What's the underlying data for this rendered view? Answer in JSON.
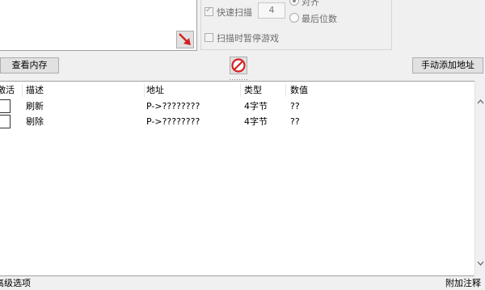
{
  "options": {
    "fast_scan_label": "快速扫描",
    "fast_scan_value": "4",
    "align_label": "对齐",
    "last_digits_label": "最后位数",
    "pause_game_label": "扫描时暂停游戏"
  },
  "buttons": {
    "view_memory": "查看内存",
    "add_address_manually": "手动添加地址"
  },
  "table": {
    "columns": [
      "激活",
      "描述",
      "地址",
      "类型",
      "数值"
    ],
    "rows": [
      {
        "description": "刷新",
        "address": "P->????????",
        "type": "4字节",
        "value": "??"
      },
      {
        "description": "剔除",
        "address": "P->????????",
        "type": "4字节",
        "value": "??"
      }
    ]
  },
  "footer": {
    "advanced_options": "高级选项",
    "extra_comment": "附加注释"
  }
}
